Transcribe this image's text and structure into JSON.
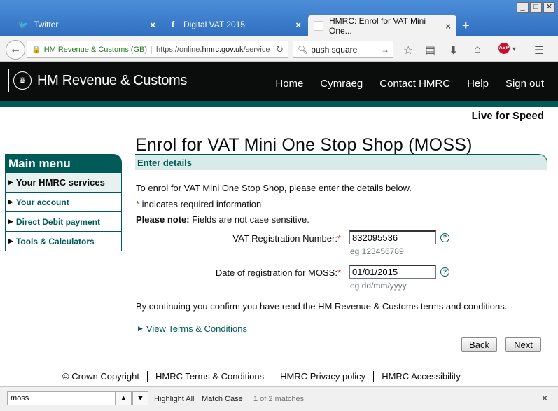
{
  "window": {
    "minimize": "_",
    "maximize": "□",
    "close": "✕"
  },
  "tabs": [
    {
      "label": "Twitter",
      "icon": "twitter-bird-icon",
      "glyph": "🐦"
    },
    {
      "label": "Digital VAT 2015",
      "icon": "facebook-icon",
      "glyph": "f"
    },
    {
      "label": "HMRC: Enrol for VAT Mini One...",
      "icon": "blank-page-icon",
      "glyph": ""
    }
  ],
  "tab_close": "×",
  "new_tab": "+",
  "toolbar": {
    "identity": "HM Revenue & Customs (GB)",
    "url_prefix": "https://online.",
    "url_domain": "hmrc.gov.uk",
    "url_suffix": "/service",
    "search_value": "push square"
  },
  "site": {
    "logo_text": "HM Revenue & Customs",
    "nav": [
      "Home",
      "Cymraeg",
      "Contact HMRC",
      "Help",
      "Sign out"
    ],
    "service_name": "Live for Speed"
  },
  "sidebar": {
    "heading": "Main menu",
    "items": [
      "Your HMRC services",
      "Your account",
      "Direct Debit payment",
      "Tools & Calculators"
    ]
  },
  "main": {
    "title": "Enrol for VAT Mini One Stop Shop (MOSS)",
    "section_heading": "Enter details",
    "intro": "To enrol for VAT Mini One Stop Shop, please enter the details below.",
    "required_marker": "*",
    "required_note": " indicates required information",
    "note_label": "Please note:",
    "note_text": " Fields are not case sensitive.",
    "vat_label": "VAT Registration Number:",
    "vat_value": "832095536",
    "vat_hint": "eg 123456789",
    "date_label": "Date of registration for MOSS:",
    "date_value": "01/01/2015",
    "date_hint": "eg dd/mm/yyyy",
    "help_glyph": "?",
    "confirm_text": "By continuing you confirm you have read the HM Revenue & Customs terms and conditions.",
    "terms_link": "View Terms & Conditions",
    "back_button": "Back",
    "next_button": "Next"
  },
  "footer": [
    "© Crown Copyright",
    "HMRC Terms & Conditions",
    "HMRC Privacy policy",
    "HMRC Accessibility"
  ],
  "findbar": {
    "query": "moss",
    "highlight_all": "Highlight All",
    "match_case": "Match Case",
    "status": "1 of 2 matches",
    "close": "✕"
  },
  "colors": {
    "hmrc_green": "#005a57",
    "header_black": "#0b0c0c",
    "required_red": "#d4351c"
  }
}
